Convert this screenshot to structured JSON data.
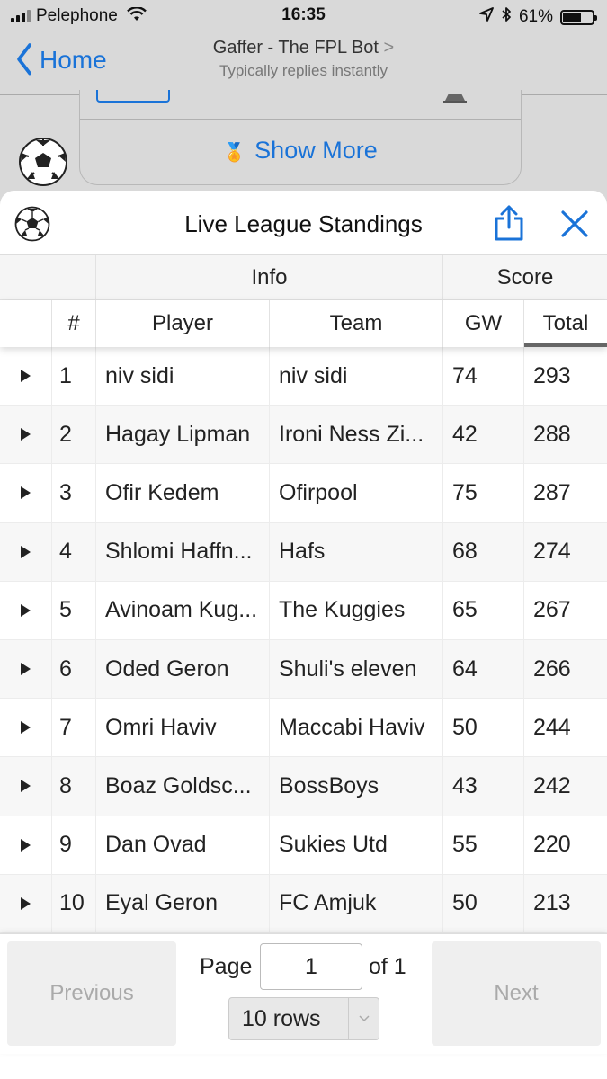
{
  "status_bar": {
    "carrier": "Pelephone",
    "time": "16:35",
    "battery": "61%",
    "battery_level": 0.61
  },
  "nav": {
    "back_label": "Home",
    "title": "Gaffer - The FPL Bot",
    "title_chevron": ">",
    "subtitle": "Typically replies instantly"
  },
  "chat": {
    "show_more": "Show More"
  },
  "sheet": {
    "title": "Live League Standings"
  },
  "table": {
    "groups": [
      "",
      "Info",
      "Score"
    ],
    "columns": [
      "",
      "#",
      "Player",
      "Team",
      "GW",
      "Total"
    ],
    "sorted_column": "Total",
    "rows": [
      {
        "rank": "1",
        "player": "niv sidi",
        "team": "niv sidi",
        "gw": "74",
        "total": "293"
      },
      {
        "rank": "2",
        "player": "Hagay Lipman",
        "team": "Ironi Ness Zi...",
        "gw": "42",
        "total": "288"
      },
      {
        "rank": "3",
        "player": "Ofir Kedem",
        "team": "Ofirpool",
        "gw": "75",
        "total": "287"
      },
      {
        "rank": "4",
        "player": "Shlomi Haffn...",
        "team": "Hafs",
        "gw": "68",
        "total": "274"
      },
      {
        "rank": "5",
        "player": "Avinoam Kug...",
        "team": "The Kuggies",
        "gw": "65",
        "total": "267"
      },
      {
        "rank": "6",
        "player": "Oded Geron",
        "team": "Shuli's eleven",
        "gw": "64",
        "total": "266"
      },
      {
        "rank": "7",
        "player": "Omri Haviv",
        "team": "Maccabi Haviv",
        "gw": "50",
        "total": "244"
      },
      {
        "rank": "8",
        "player": "Boaz Goldsc...",
        "team": "BossBoys",
        "gw": "43",
        "total": "242"
      },
      {
        "rank": "9",
        "player": "Dan Ovad",
        "team": "Sukies Utd",
        "gw": "55",
        "total": "220"
      },
      {
        "rank": "10",
        "player": "Eyal Geron",
        "team": "FC Amjuk",
        "gw": "50",
        "total": "213"
      }
    ]
  },
  "pagination": {
    "previous_label": "Previous",
    "next_label": "Next",
    "page_label": "Page",
    "page_value": "1",
    "of_label": "of 1",
    "rows_select": "10 rows"
  },
  "colors": {
    "accent": "#1a73d8",
    "dim_bg": "#d9d9d9"
  }
}
